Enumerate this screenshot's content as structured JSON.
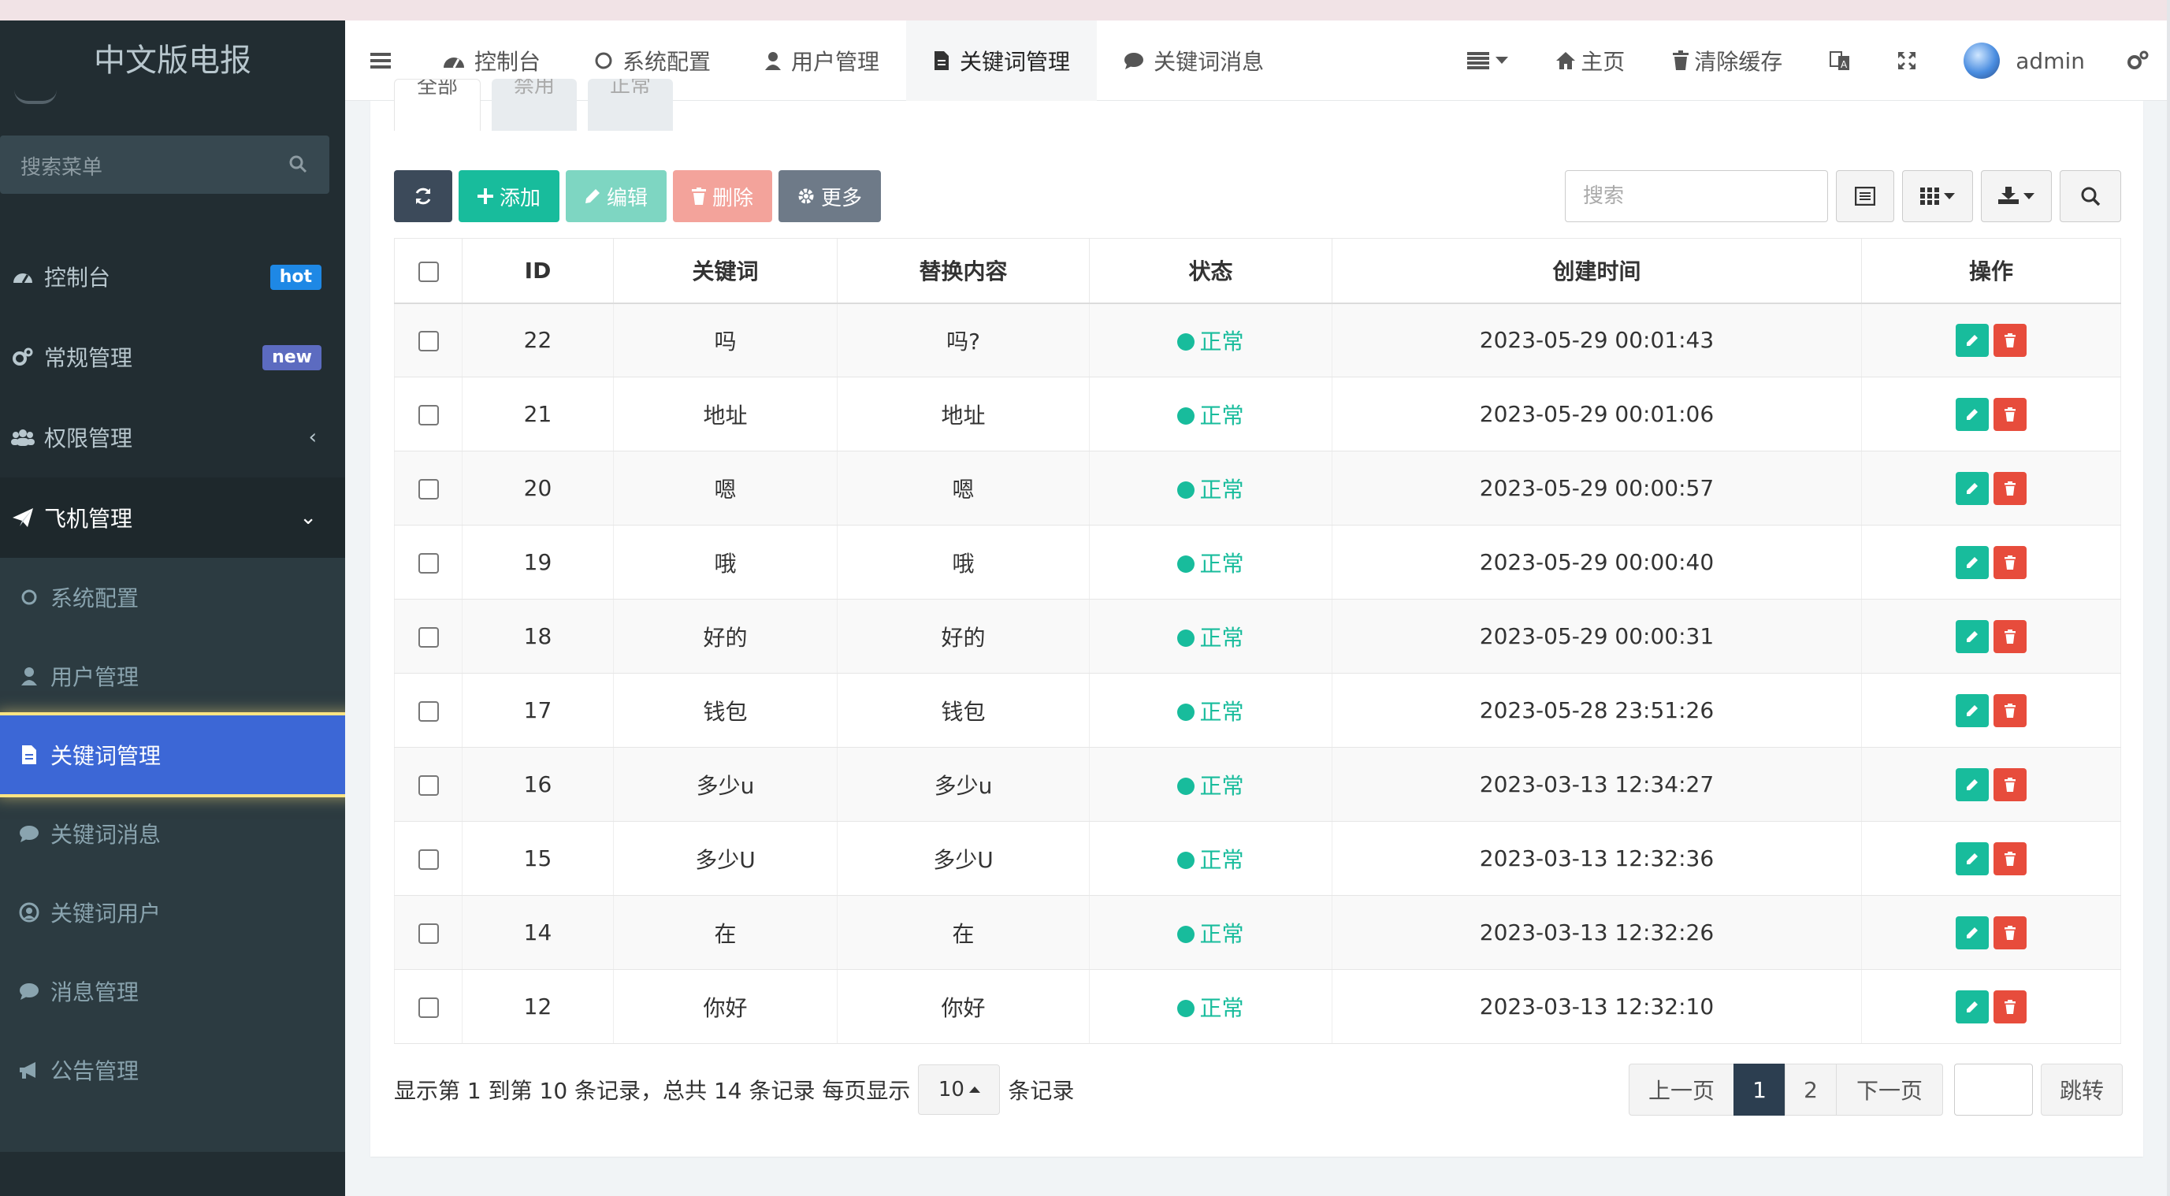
{
  "app": {
    "brand": "中文版电报"
  },
  "sidebar": {
    "search_placeholder": "搜索菜单",
    "items": [
      {
        "label": "控制台",
        "badge": "hot",
        "badge_color": "#1e88e5"
      },
      {
        "label": "常规管理",
        "badge": "new",
        "badge_color": "#5c6bc0"
      },
      {
        "label": "权限管理",
        "arrow": "‹"
      },
      {
        "label": "飞机管理",
        "arrow": "⌄"
      }
    ],
    "subitems": [
      {
        "label": "系统配置"
      },
      {
        "label": "用户管理"
      },
      {
        "label": "关键词管理"
      },
      {
        "label": "关键词消息"
      },
      {
        "label": "关键词用户"
      },
      {
        "label": "消息管理"
      },
      {
        "label": "公告管理"
      }
    ]
  },
  "header": {
    "tabs": [
      {
        "label": "控制台"
      },
      {
        "label": "系统配置"
      },
      {
        "label": "用户管理"
      },
      {
        "label": "关键词管理"
      },
      {
        "label": "关键词消息"
      }
    ],
    "home": "主页",
    "clear_cache": "清除缓存",
    "user": "admin"
  },
  "subtabs": [
    "全部",
    "禁用",
    "正常"
  ],
  "toolbar": {
    "add": "添加",
    "edit": "编辑",
    "delete": "删除",
    "more": "更多",
    "search_placeholder": "搜索"
  },
  "table": {
    "columns": [
      "ID",
      "关键词",
      "替换内容",
      "状态",
      "创建时间",
      "操作"
    ],
    "rows": [
      {
        "id": "22",
        "keyword": "吗",
        "replace": "吗?",
        "status": "正常",
        "created": "2023-05-29 00:01:43"
      },
      {
        "id": "21",
        "keyword": "地址",
        "replace": "地址",
        "status": "正常",
        "created": "2023-05-29 00:01:06"
      },
      {
        "id": "20",
        "keyword": "嗯",
        "replace": "嗯",
        "status": "正常",
        "created": "2023-05-29 00:00:57"
      },
      {
        "id": "19",
        "keyword": "哦",
        "replace": "哦",
        "status": "正常",
        "created": "2023-05-29 00:00:40"
      },
      {
        "id": "18",
        "keyword": "好的",
        "replace": "好的",
        "status": "正常",
        "created": "2023-05-29 00:00:31"
      },
      {
        "id": "17",
        "keyword": "钱包",
        "replace": "钱包",
        "status": "正常",
        "created": "2023-05-28 23:51:26"
      },
      {
        "id": "16",
        "keyword": "多少u",
        "replace": "多少u",
        "status": "正常",
        "created": "2023-03-13 12:34:27"
      },
      {
        "id": "15",
        "keyword": "多少U",
        "replace": "多少U",
        "status": "正常",
        "created": "2023-03-13 12:32:36"
      },
      {
        "id": "14",
        "keyword": "在",
        "replace": "在",
        "status": "正常",
        "created": "2023-03-13 12:32:26"
      },
      {
        "id": "12",
        "keyword": "你好",
        "replace": "你好",
        "status": "正常",
        "created": "2023-03-13 12:32:10"
      }
    ]
  },
  "pagination": {
    "info": "显示第 1 到第 10 条记录，总共 14 条记录 每页显示",
    "page_size": "10",
    "suffix": "条记录",
    "prev": "上一页",
    "pages": [
      "1",
      "2"
    ],
    "current": "1",
    "next": "下一页",
    "jump": "跳转"
  }
}
